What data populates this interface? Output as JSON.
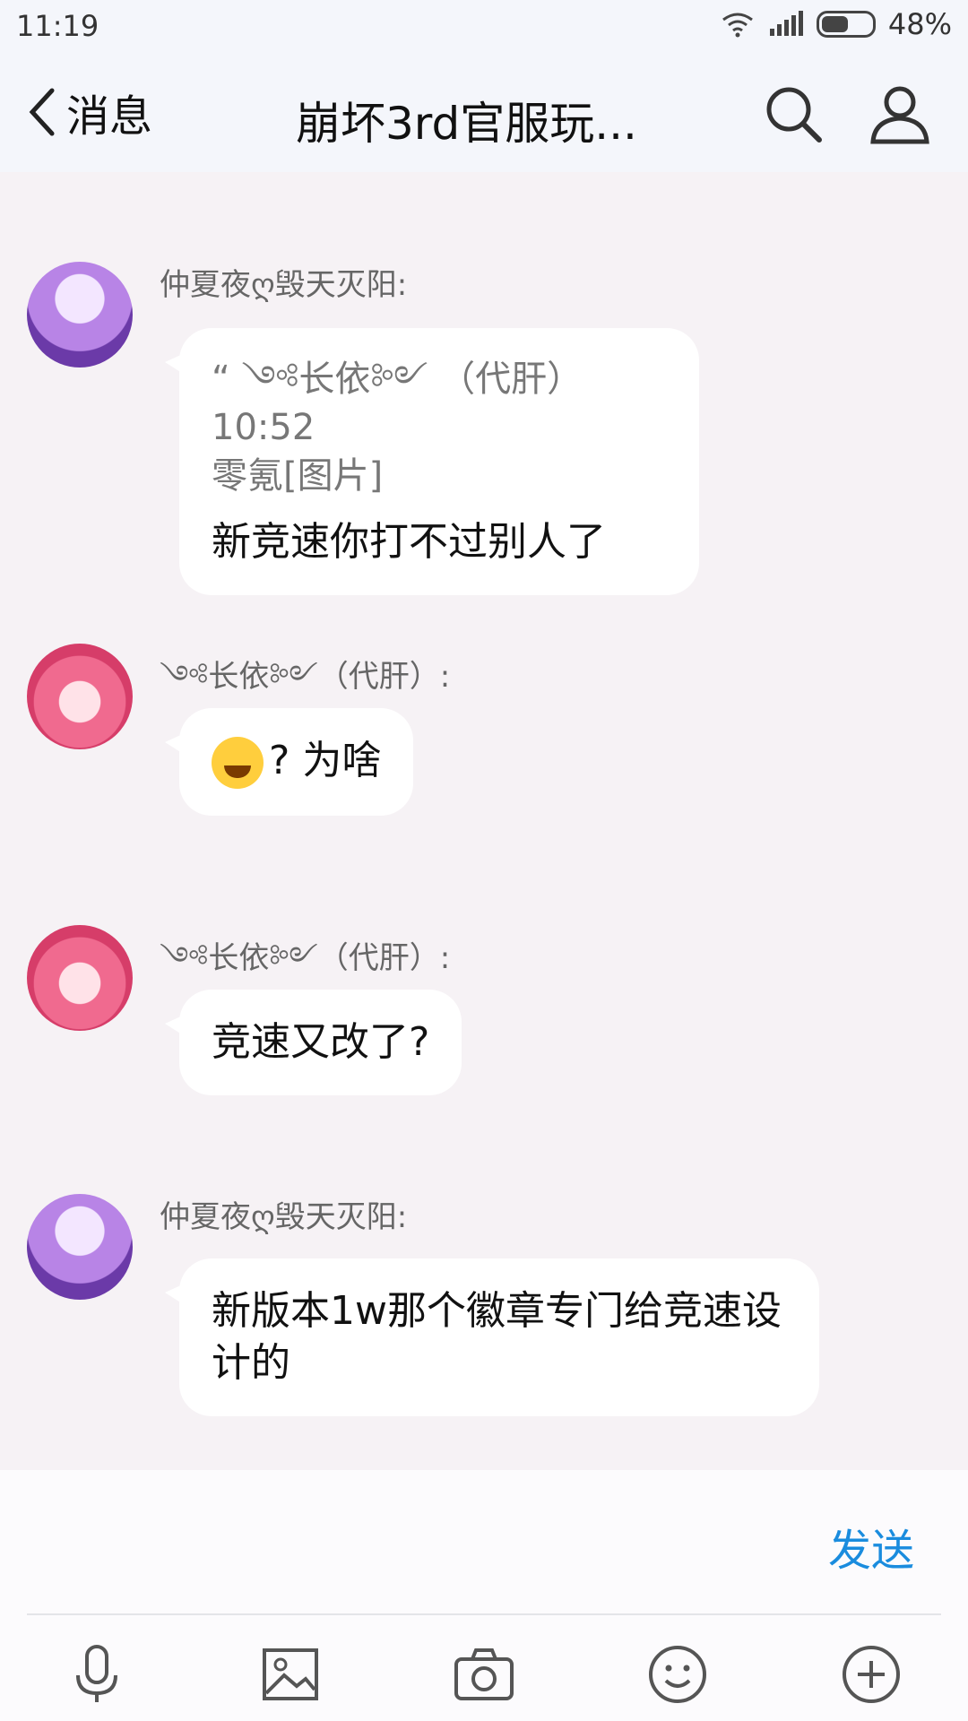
{
  "status": {
    "time": "11:19",
    "battery": "48%"
  },
  "header": {
    "back_label": "消息",
    "title": "崩坏3rd官服玩..."
  },
  "messages": [
    {
      "sender": "仲夏夜ღ毁天灭阳:",
      "quote_line1": "“ ༺长依༻ （代肝）10:52",
      "quote_line2": "零氪[图片]",
      "text": "新竞速你打不过别人了"
    },
    {
      "sender": "༺长依༻（代肝）:",
      "text": "? 为啥"
    },
    {
      "sender": "༺长依༻（代肝）:",
      "text": "竞速又改了?"
    },
    {
      "sender": "仲夏夜ღ毁天灭阳:",
      "text": "新版本1w那个徽章专门给竞速设计的"
    }
  ],
  "input": {
    "send_label": "发送"
  },
  "colors": {
    "accent": "#1a8cde",
    "background": "#f6f2f5"
  }
}
